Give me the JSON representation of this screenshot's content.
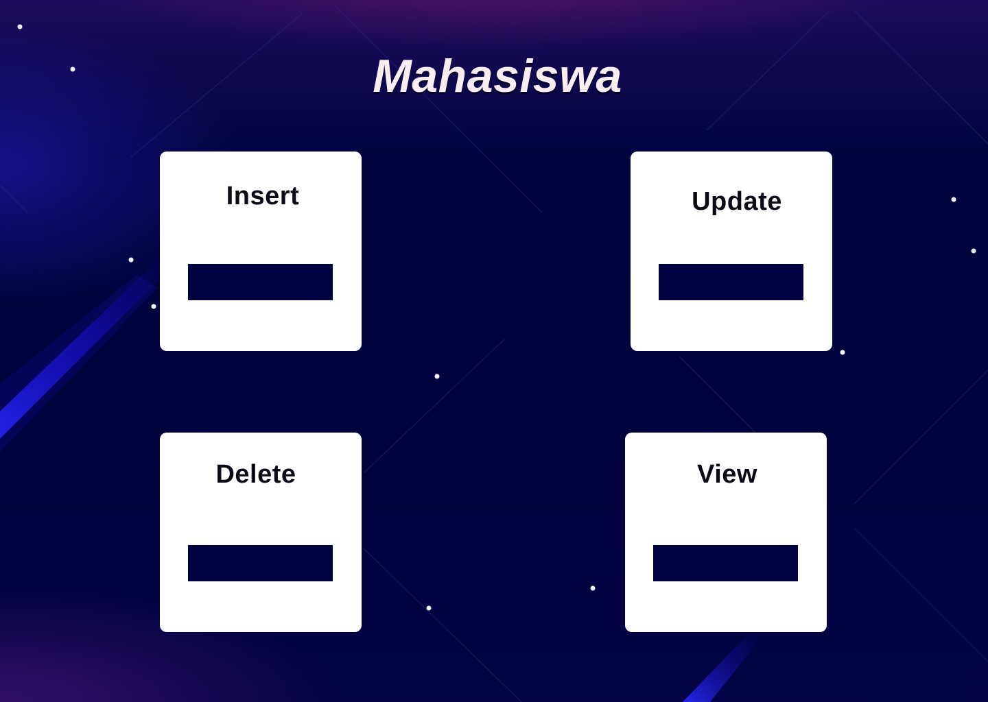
{
  "page": {
    "title": "Mahasiswa"
  },
  "cards": [
    {
      "id": "insert",
      "label": "Insert"
    },
    {
      "id": "update",
      "label": "Update"
    },
    {
      "id": "delete",
      "label": "Delete"
    },
    {
      "id": "view",
      "label": "View"
    }
  ],
  "colors": {
    "background": "#01033d",
    "card": "#ffffff",
    "action_button": "#020140",
    "title_text": "#f8eef0",
    "label_text": "#0b0b18",
    "accent_beam": "#1a1aff"
  }
}
